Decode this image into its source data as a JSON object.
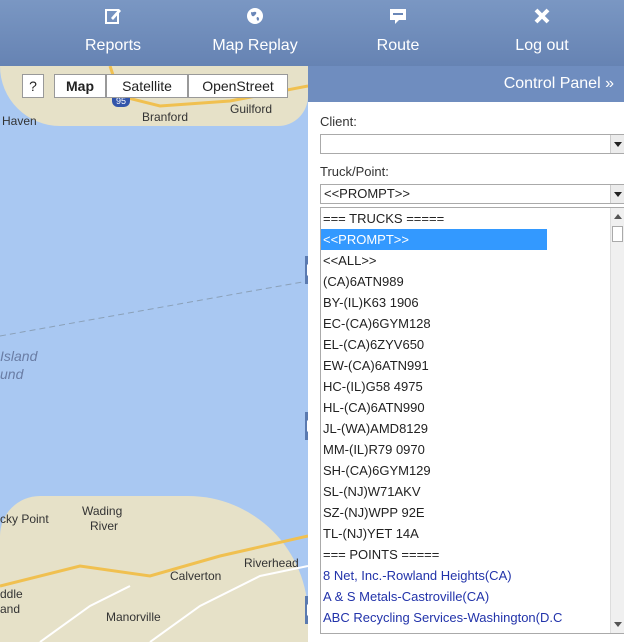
{
  "nav": {
    "items": [
      {
        "label": "Reports",
        "icon": "edit-icon"
      },
      {
        "label": "Map Replay",
        "icon": "globe-icon"
      },
      {
        "label": "Route",
        "icon": "speech-bubble-icon"
      },
      {
        "label": "Log out",
        "icon": "close-icon"
      }
    ]
  },
  "map": {
    "help_label": "?",
    "types": [
      "Map",
      "Satellite",
      "OpenStreet"
    ],
    "active_type": "Map",
    "route_shield": "95",
    "places": [
      "Haven",
      "Branford",
      "Guilford",
      "Island",
      "und",
      "Wading",
      "River",
      "cky Point",
      "Riverhead",
      "Calverton",
      "ddle",
      "and",
      "Manorville"
    ]
  },
  "control_panel": {
    "title": "Control Panel",
    "collapse_glyph": "»",
    "client_label": "Client:",
    "client_value": "",
    "truck_label": "Truck/Point:",
    "truck_value": "<<PROMPT>>",
    "list": [
      {
        "text": "=== TRUCKS =====",
        "kind": "header"
      },
      {
        "text": "<<PROMPT>>",
        "kind": "selected"
      },
      {
        "text": "<<ALL>>",
        "kind": "truck"
      },
      {
        "text": "(CA)6ATN989",
        "kind": "truck"
      },
      {
        "text": "BY-(IL)K63 1906",
        "kind": "truck"
      },
      {
        "text": "EC-(CA)6GYM128",
        "kind": "truck"
      },
      {
        "text": "EL-(CA)6ZYV650",
        "kind": "truck"
      },
      {
        "text": "EW-(CA)6ATN991",
        "kind": "truck"
      },
      {
        "text": "HC-(IL)G58 4975",
        "kind": "truck"
      },
      {
        "text": "HL-(CA)6ATN990",
        "kind": "truck"
      },
      {
        "text": "JL-(WA)AMD8129",
        "kind": "truck"
      },
      {
        "text": "MM-(IL)R79 0970",
        "kind": "truck"
      },
      {
        "text": "SH-(CA)6GYM129",
        "kind": "truck"
      },
      {
        "text": "SL-(NJ)W71AKV",
        "kind": "truck"
      },
      {
        "text": "SZ-(NJ)WPP 92E",
        "kind": "truck"
      },
      {
        "text": "TL-(NJ)YET 14A",
        "kind": "truck"
      },
      {
        "text": "=== POINTS =====",
        "kind": "header"
      },
      {
        "text": "8 Net, Inc.-Rowland Heights(CA)",
        "kind": "point"
      },
      {
        "text": "A & S Metals-Castroville(CA)",
        "kind": "point"
      },
      {
        "text": "ABC Recycling Services-Washington(D.C",
        "kind": "point"
      }
    ]
  },
  "colors": {
    "nav_bg": "#7390bf",
    "selection": "#3399ff",
    "point_text": "#2233aa",
    "water": "#a9c8f2",
    "land": "#e6e1c8"
  }
}
